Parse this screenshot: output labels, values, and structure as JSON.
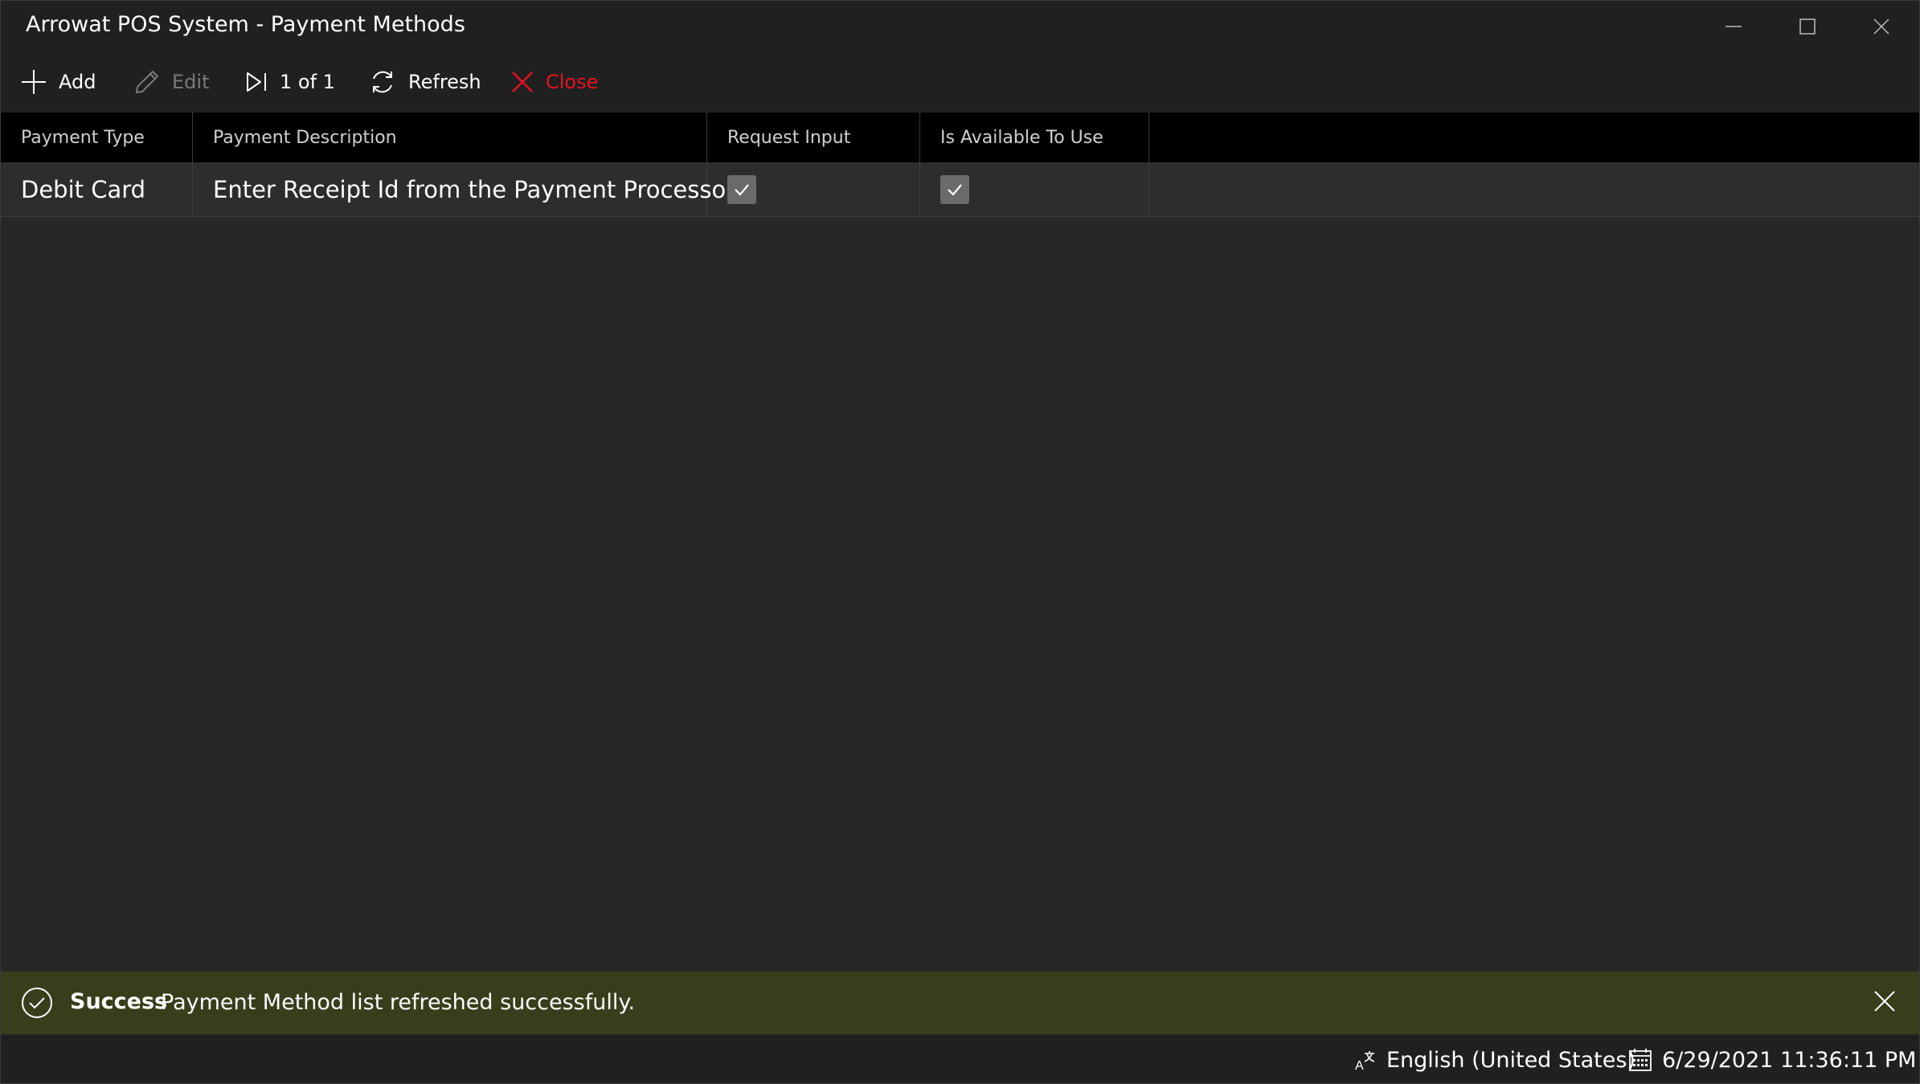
{
  "window": {
    "title": "Arrowat POS System - Payment Methods"
  },
  "toolbar": {
    "add_label": "Add",
    "edit_label": "Edit",
    "page_indicator": "1 of 1",
    "refresh_label": "Refresh",
    "close_label": "Close"
  },
  "grid": {
    "columns": [
      "Payment Type",
      "Payment Description",
      "Request Input",
      "Is Available To Use"
    ],
    "rows": [
      {
        "payment_type": "Debit Card",
        "payment_description": "Enter Receipt Id from the Payment Processor",
        "request_input": true,
        "is_available": true
      }
    ]
  },
  "notification": {
    "title": "Success",
    "message": "Payment Method list refreshed successfully."
  },
  "status": {
    "language": "English (United States)",
    "datetime": "6/29/2021 11:36:11 PM"
  },
  "colors": {
    "danger": "#e81123",
    "success_bar": "#393d1b",
    "header_bg": "#000000"
  },
  "icons": {
    "add": "plus-icon",
    "edit": "pencil-icon",
    "page": "skip-to-end-icon",
    "refresh": "refresh-icon",
    "close": "close-x-icon",
    "success": "check-circle-icon",
    "language": "language-icon",
    "calendar": "calendar-icon"
  }
}
